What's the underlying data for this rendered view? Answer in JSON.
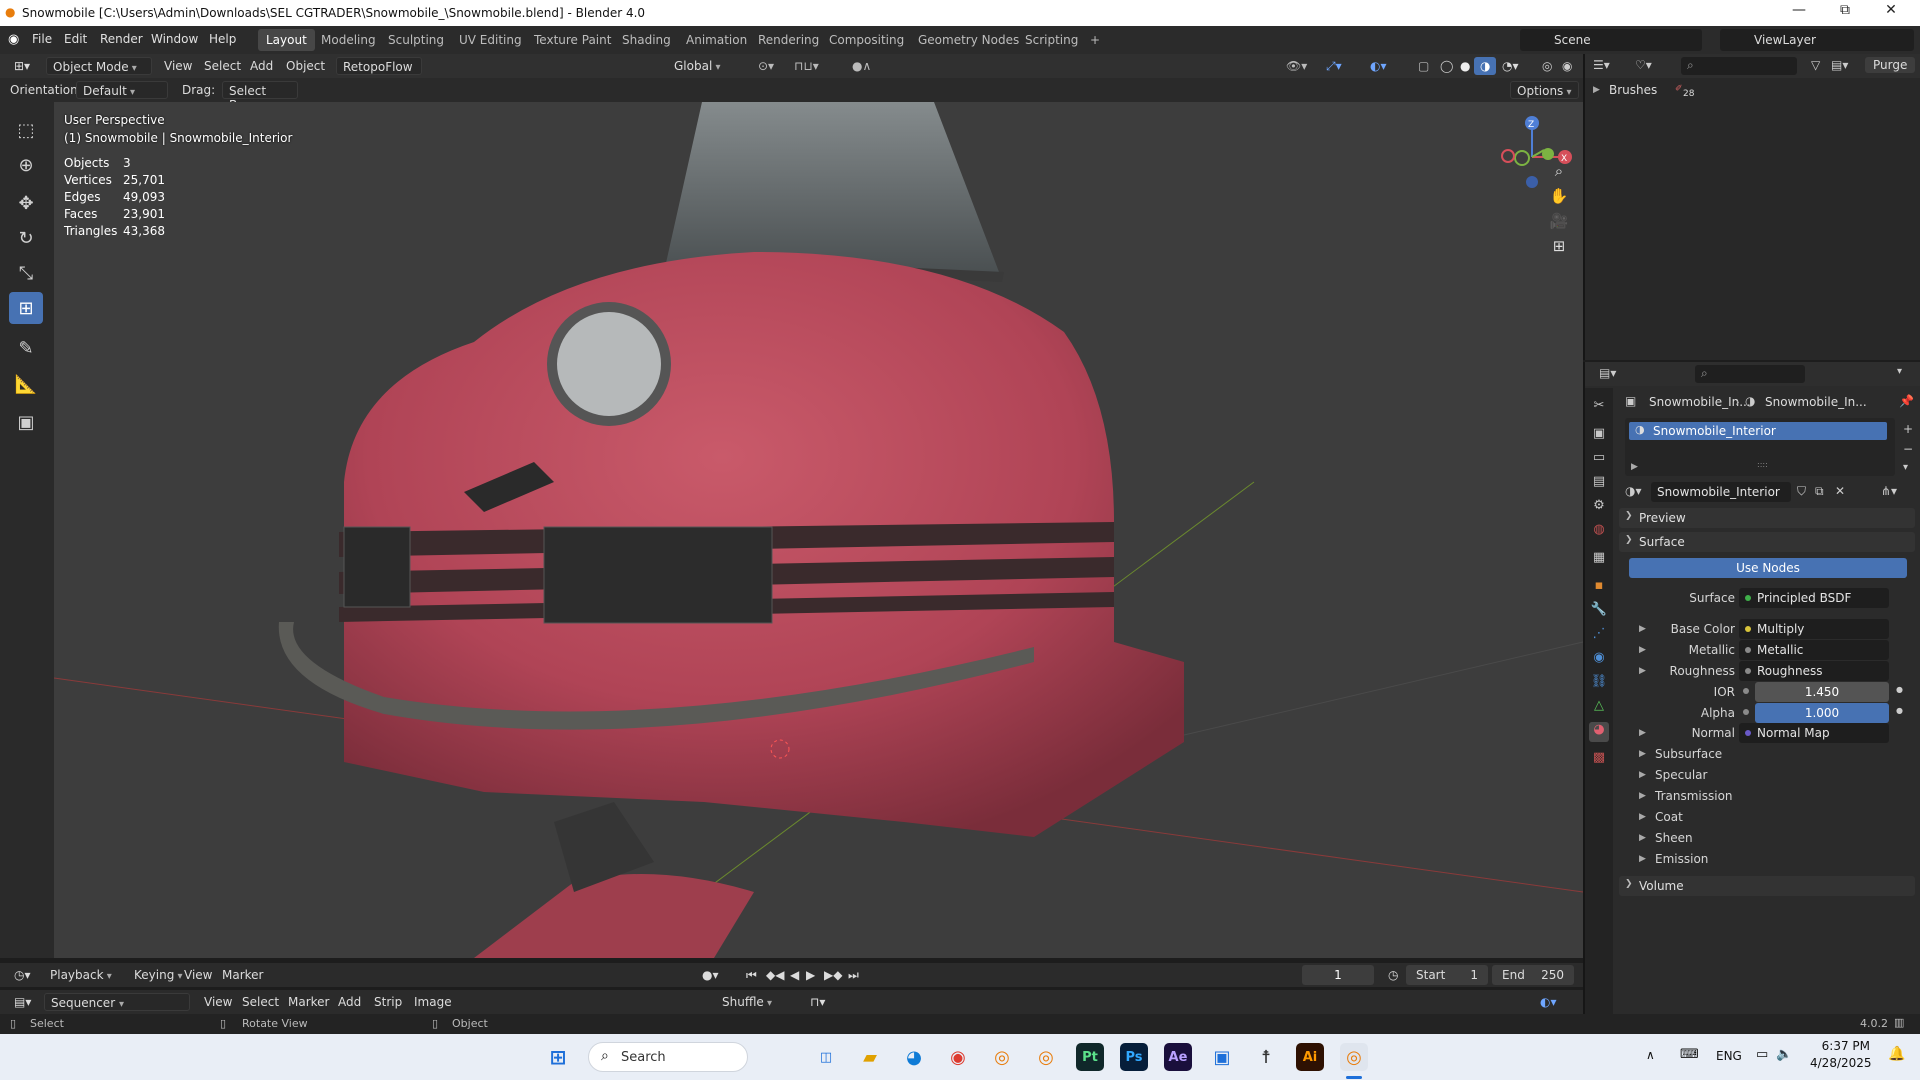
{
  "window": {
    "title": "Snowmobile [C:\\Users\\Admin\\Downloads\\SEL CGTRADER\\Snowmobile_\\Snowmobile.blend] - Blender 4.0",
    "minimize": "—",
    "maximize": "⧉",
    "close": "✕"
  },
  "menu": {
    "items": [
      "File",
      "Edit",
      "Render",
      "Window",
      "Help"
    ],
    "workspaces": [
      "Layout",
      "Modeling",
      "Sculpting",
      "UV Editing",
      "Texture Paint",
      "Shading",
      "Animation",
      "Rendering",
      "Compositing",
      "Geometry Nodes",
      "Scripting"
    ],
    "add_workspace": "+",
    "scene_label": "Scene",
    "viewlayer_label": "ViewLayer"
  },
  "viewport_header": {
    "mode": "Object Mode",
    "menus": [
      "View",
      "Select",
      "Add",
      "Object"
    ],
    "addon": "RetopoFlow",
    "transform": "Global",
    "orientation_label": "Orientation:",
    "orientation_value": "Default",
    "drag_label": "Drag:",
    "drag_value": "Select Box",
    "options": "Options"
  },
  "overlay": {
    "view_name": "User Perspective",
    "object_path": "(1) Snowmobile | Snowmobile_Interior",
    "stats": [
      {
        "key": "Objects",
        "value": "3"
      },
      {
        "key": "Vertices",
        "value": "25,701"
      },
      {
        "key": "Edges",
        "value": "49,093"
      },
      {
        "key": "Faces",
        "value": "23,901"
      },
      {
        "key": "Triangles",
        "value": "43,368"
      }
    ],
    "gizmo": {
      "z": "Z",
      "x": "X"
    }
  },
  "outliner": {
    "purge": "Purge",
    "item": "Brushes",
    "count": "28"
  },
  "properties": {
    "breadcrumb_object": "Snowmobile_In...",
    "breadcrumb_material": "Snowmobile_In...",
    "slot_name": "Snowmobile_Interior",
    "material_name": "Snowmobile_Interior",
    "panels": {
      "preview": "Preview",
      "surface": "Surface",
      "use_nodes": "Use Nodes",
      "volume": "Volume"
    },
    "rows": [
      {
        "label": "Surface",
        "value": "Principled BSDF",
        "dot": "#3fb04a"
      },
      {
        "label": "Base Color",
        "value": "Multiply",
        "dot": "#d8c43a"
      },
      {
        "label": "Metallic",
        "value": "Metallic",
        "dot": "#8a8a8a"
      },
      {
        "label": "Roughness",
        "value": "Roughness",
        "dot": "#8a8a8a"
      }
    ],
    "ior": {
      "label": "IOR",
      "value": "1.450"
    },
    "alpha": {
      "label": "Alpha",
      "value": "1.000"
    },
    "normal": {
      "label": "Normal",
      "value": "Normal Map",
      "dot": "#6a5ac8"
    },
    "subpanels": [
      "Subsurface",
      "Specular",
      "Transmission",
      "Coat",
      "Sheen",
      "Emission"
    ]
  },
  "timeline": {
    "menus": [
      "Playback",
      "Keying",
      "View",
      "Marker"
    ],
    "current_frame": "1",
    "start_label": "Start",
    "start_value": "1",
    "end_label": "End",
    "end_value": "250"
  },
  "sequencer": {
    "editor": "Sequencer",
    "menus": [
      "View",
      "Select",
      "Marker",
      "Add",
      "Strip",
      "Image"
    ],
    "shuffle": "Shuffle"
  },
  "statusbar": {
    "select": "Select",
    "rotate": "Rotate View",
    "object": "Object",
    "version": "4.0.2"
  },
  "taskbar": {
    "search": "Search",
    "lang": "ENG",
    "time": "6:37 PM",
    "date": "4/28/2025",
    "apps": [
      "Pt",
      "Ps",
      "Ae",
      "Ai"
    ]
  },
  "colors": {
    "accent": "#4772b3",
    "body_red": "#b8485a"
  }
}
